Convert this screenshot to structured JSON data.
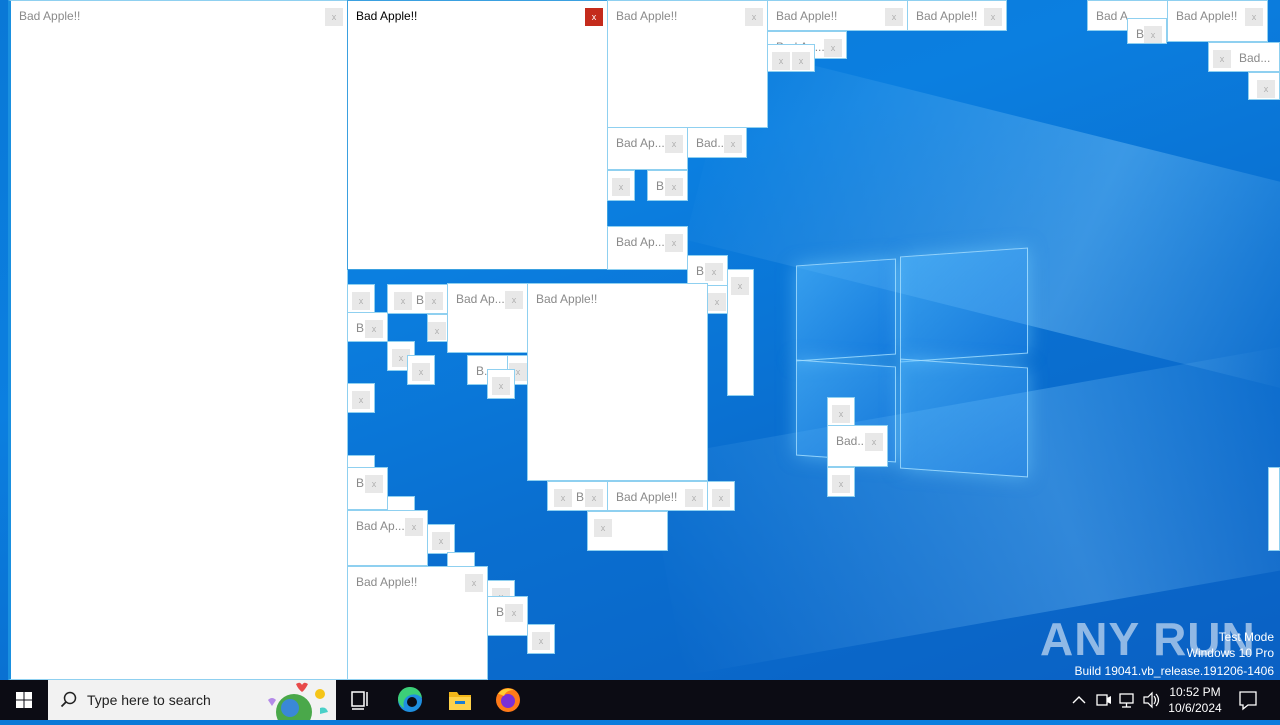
{
  "window_title": "Bad Apple!!",
  "close_glyph": "x",
  "titles": {
    "full": "Bad Apple!!",
    "ap": "Bad Ap...",
    "bad": "Bad...",
    "b": "B.",
    "bada": "Bad A",
    "badap_short": "Bad Ap..."
  },
  "taskbar": {
    "search_placeholder": "Type here to search",
    "icons": [
      "windows-start-icon",
      "search-icon",
      "task-view-icon",
      "edge-icon",
      "file-explorer-icon",
      "firefox-icon"
    ]
  },
  "tray": {
    "time": "10:52 PM",
    "date": "10/6/2024",
    "icons": [
      "chevron-up-icon",
      "meet-now-icon",
      "network-icon",
      "volume-icon",
      "notification-icon"
    ]
  },
  "watermark": {
    "test_mode": "Test Mode",
    "edition": "Windows 10 Pro",
    "build": "Build 19041.vb_release.191206-1406"
  },
  "brand": "ANY RUN",
  "colors": {
    "accent": "#0a78d6",
    "close_active": "#c42b1c",
    "taskbar": "#0c0c14"
  }
}
